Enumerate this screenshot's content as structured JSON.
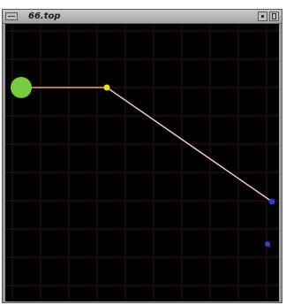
{
  "window": {
    "title": "66.top"
  },
  "icons": {
    "menu": "window-menu-icon",
    "minimize": "minimize-icon",
    "maximize": "maximize-icon"
  },
  "colors": {
    "canvas_background": "#000000",
    "grid": "#3a1a1a",
    "node_start": "#77cc44",
    "node_mid": "#e8e02a",
    "node_end": "#2a3fd0",
    "edge_start": "#f0a070",
    "edge_main": "#f0c8c0"
  }
}
